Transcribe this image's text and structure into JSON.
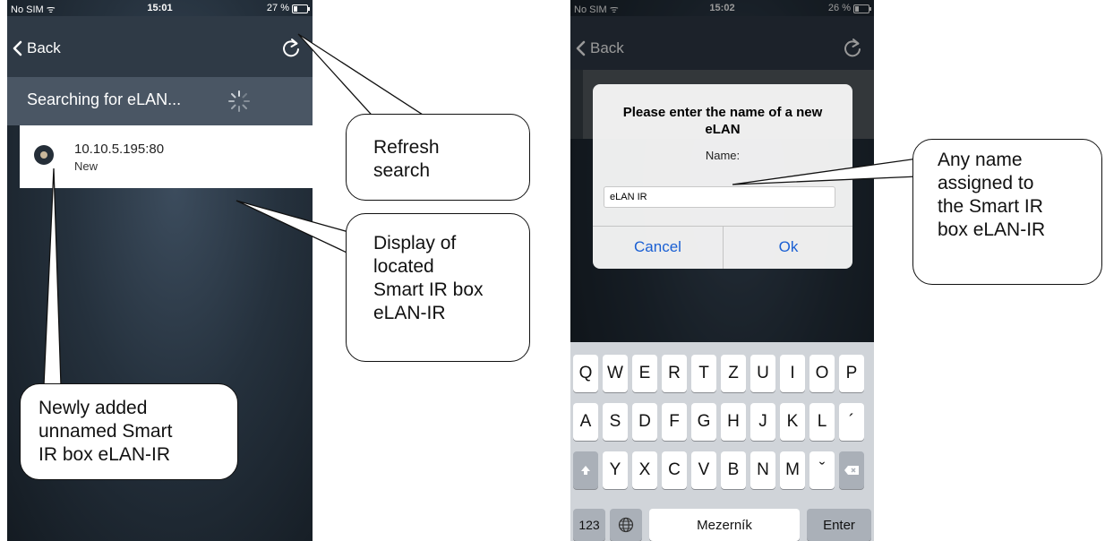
{
  "left_screen": {
    "status": {
      "carrier": "No SIM ᯤ",
      "time": "15:01",
      "battery": "27 %"
    },
    "nav": {
      "back": "Back",
      "refresh_icon": "refresh-icon"
    },
    "search_text": "Searching for eLAN...",
    "device": {
      "ip": "10.10.5.195:80",
      "status": "New"
    }
  },
  "right_screen": {
    "status": {
      "carrier": "No SIM ᯤ",
      "time": "15:02",
      "battery": "26 %"
    },
    "nav": {
      "back": "Back"
    },
    "dialog": {
      "title": "Please enter the name of a new eLAN",
      "subtitle": "Name:",
      "input_value": "eLAN IR",
      "cancel": "Cancel",
      "ok": "Ok"
    },
    "keyboard": {
      "row1": [
        "Q",
        "W",
        "E",
        "R",
        "T",
        "Z",
        "U",
        "I",
        "O",
        "P"
      ],
      "row2": [
        "A",
        "S",
        "D",
        "F",
        "G",
        "H",
        "J",
        "K",
        "L",
        "´"
      ],
      "row3": [
        "Y",
        "X",
        "C",
        "V",
        "B",
        "N",
        "M",
        "ˇ"
      ],
      "numbers": "123",
      "space": "Mezerník",
      "enter": "Enter"
    }
  },
  "callouts": {
    "refresh": "Refresh\nsearch",
    "display": "Display of\nlocated\nSmart IR box\neLAN-IR",
    "newly": "Newly added\nunnamed Smart\nIR box eLAN-IR",
    "name": "Any name\nassigned to\nthe Smart IR\nbox eLAN-IR"
  }
}
